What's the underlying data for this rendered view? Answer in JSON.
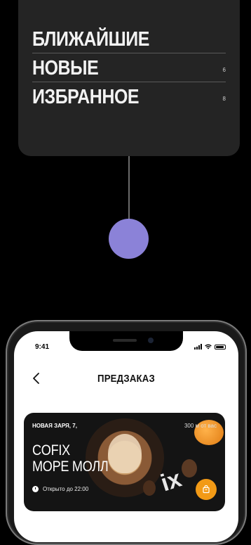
{
  "menu": {
    "items": [
      {
        "label": "БЛИЖАЙШИЕ",
        "count": ""
      },
      {
        "label": "НОВЫЕ",
        "count": "6"
      },
      {
        "label": "ИЗБРАННОЕ",
        "count": "8"
      }
    ]
  },
  "colors": {
    "accent_dot": "#8b82d8",
    "fav_button": "#f29a16",
    "card_dark": "#242424"
  },
  "phone": {
    "status_time": "9:41",
    "header": {
      "title": "ПРЕДЗАКАЗ",
      "back_icon": "chevron-left-icon"
    },
    "shop": {
      "address": "НОВАЯ ЗАРЯ, 7,",
      "distance": "300 м от вас",
      "name_line1": "COFIX",
      "name_line2": "МОРЕ МОЛЛ",
      "hours": "Открыто до 22:00",
      "fav_icon": "bag-icon"
    }
  }
}
